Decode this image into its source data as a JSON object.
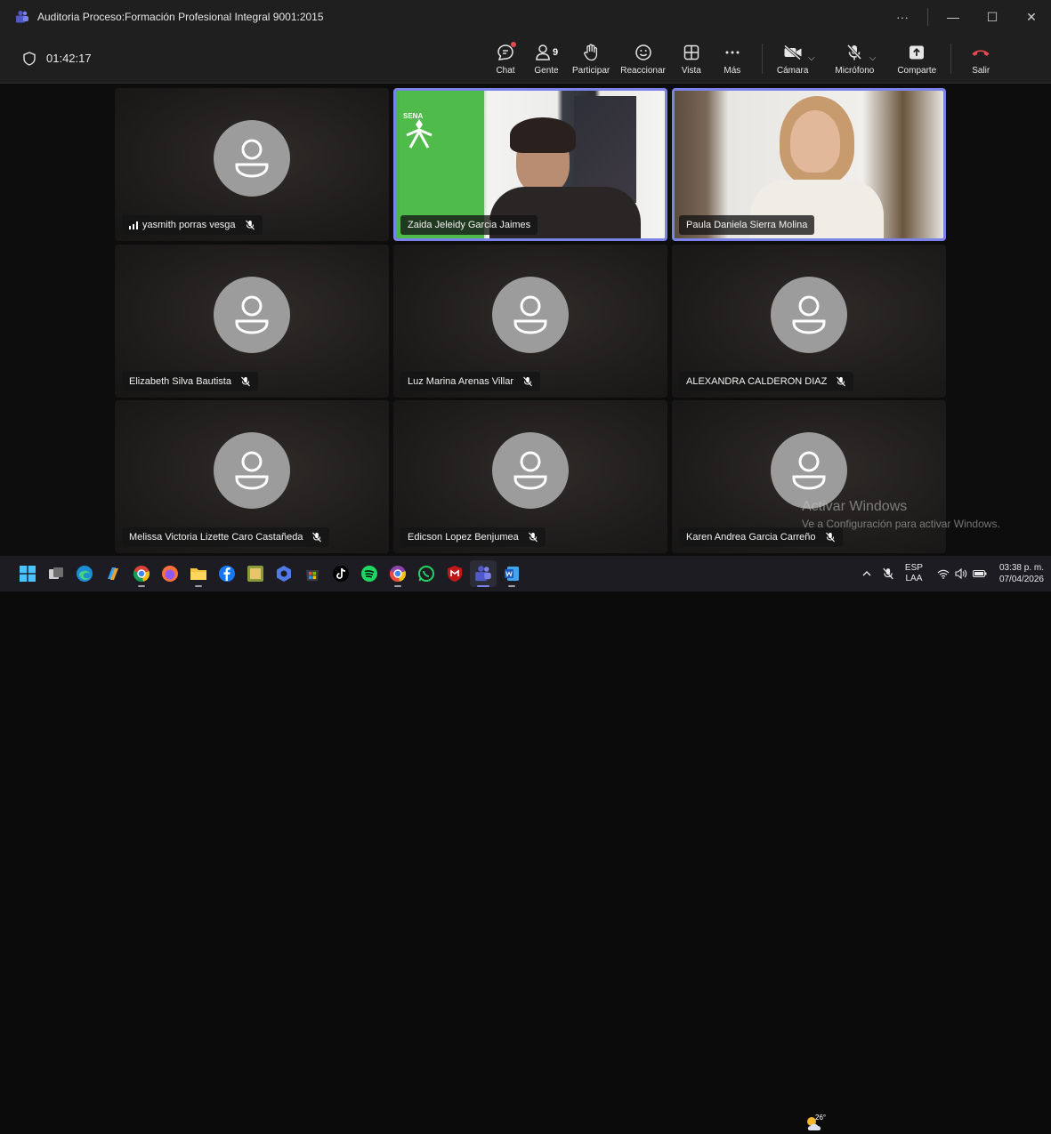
{
  "window": {
    "title": "Auditoria Proceso:Formación Profesional Integral 9001:2015",
    "more_label": "···",
    "minimize": "—",
    "maximize": "☐",
    "close": "✕"
  },
  "toolbar": {
    "timer": "01:42:17",
    "chat": "Chat",
    "people": "Gente",
    "people_count": "9",
    "raise_hand": "Participar",
    "react": "Reaccionar",
    "view": "Vista",
    "more": "Más",
    "camera": "Cámara",
    "mic": "Micrófono",
    "share": "Comparte",
    "leave": "Salir"
  },
  "participants": [
    {
      "name": "yasmith porras vesga",
      "type": "avatar",
      "speaking_bars": true
    },
    {
      "name": "Zaida Jeleidy Garcia Jaimes",
      "type": "video"
    },
    {
      "name": "Paula Daniela Sierra Molina",
      "type": "video"
    },
    {
      "name": "Elizabeth Silva Bautista",
      "type": "avatar"
    },
    {
      "name": "Luz Marina Arenas Villar",
      "type": "avatar"
    },
    {
      "name": "ALEXANDRA CALDERON DIAZ",
      "type": "avatar"
    },
    {
      "name": "Melissa Victoria Lizette Caro Castañeda",
      "type": "avatar"
    },
    {
      "name": "Edicson Lopez Benjumea",
      "type": "avatar"
    },
    {
      "name": "Karen Andrea Garcia Carreño",
      "type": "avatar"
    }
  ],
  "video_overlay_text": "SENA",
  "watermark": {
    "line1": "Activar Windows",
    "line2": "Ve a Configuración para activar Windows."
  },
  "taskbar": {
    "weather_temp": "26°",
    "lang_top": "ESP",
    "lang_bottom": "LAA",
    "time": "03:38 p. m.",
    "date": "07/04/2026",
    "apps": [
      "start-icon",
      "task-view-icon",
      "edge-icon",
      "copilot-icon",
      "chrome-icon",
      "firefox-icon",
      "file-explorer-icon",
      "facebook-icon",
      "game-icon",
      "dev-icon",
      "store-icon",
      "tiktok-icon",
      "spotify-icon",
      "chrome-profile-icon",
      "whatsapp-icon",
      "mcafee-icon",
      "teams-icon",
      "word-icon"
    ]
  },
  "colors": {
    "accent": "#7b83eb",
    "leave": "#e5484d",
    "avatar": "#9c9c9c"
  }
}
